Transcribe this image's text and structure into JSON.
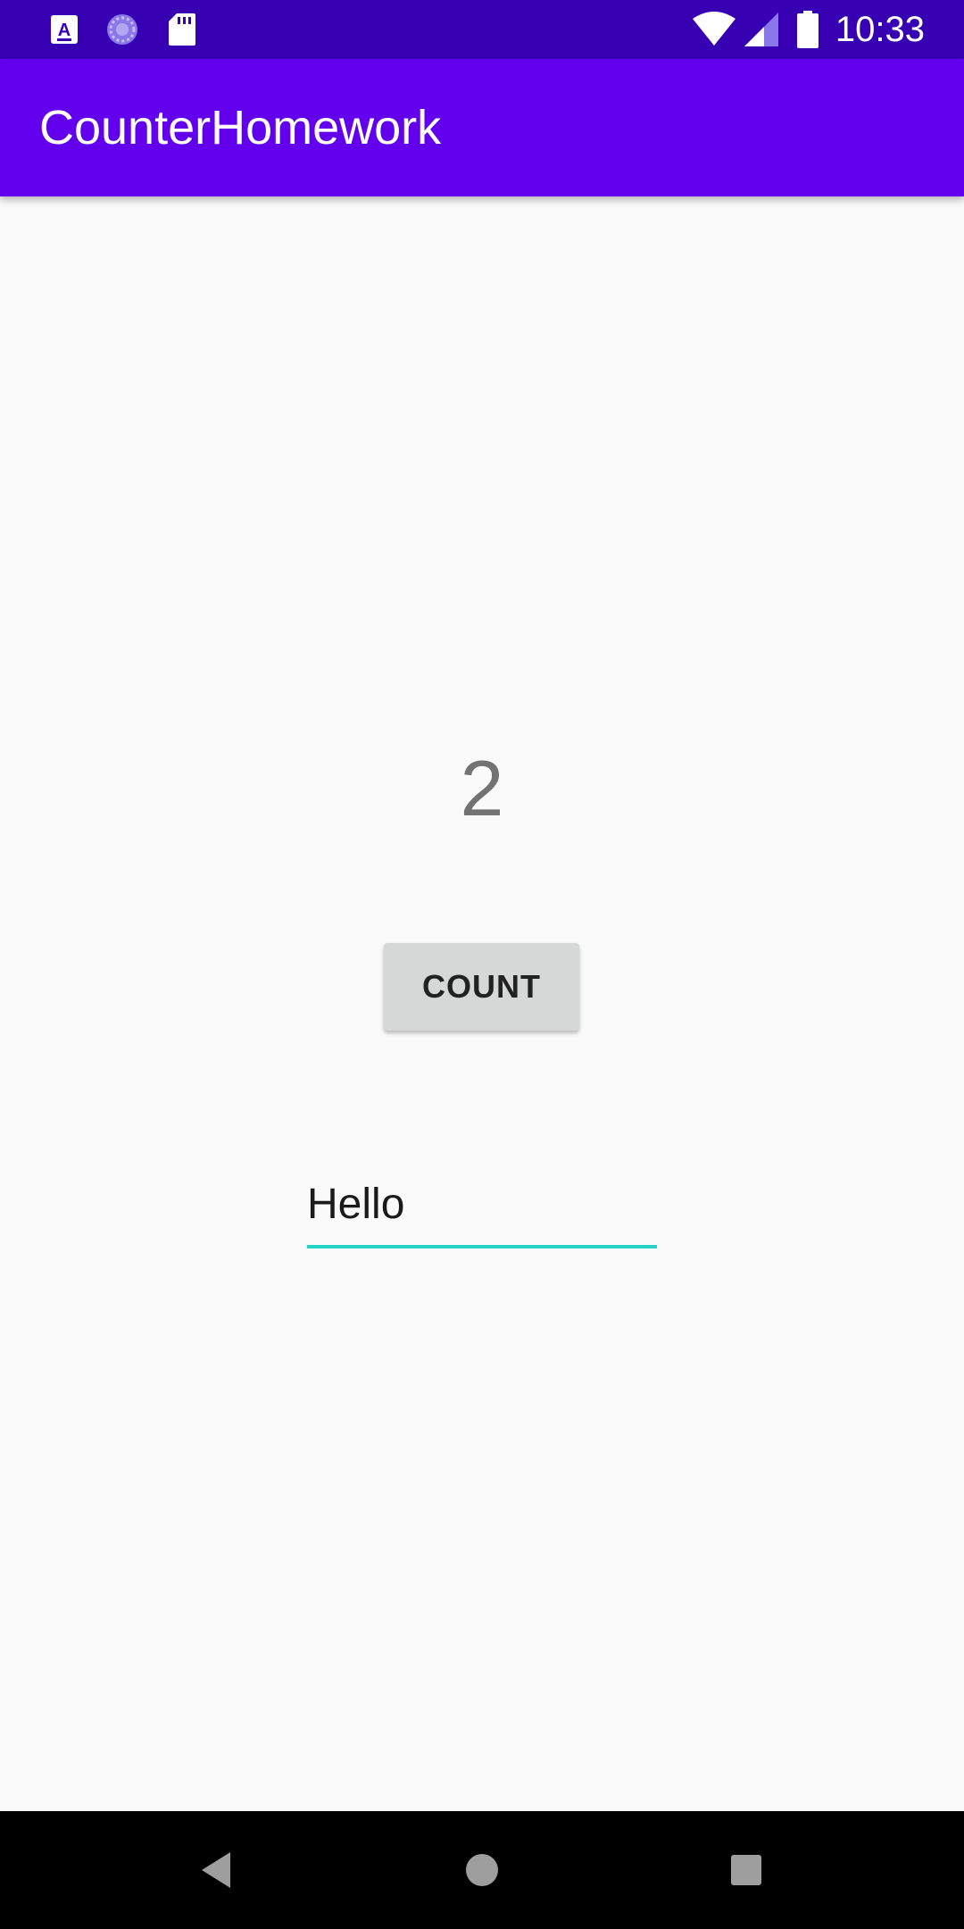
{
  "status_bar": {
    "time": "10:33",
    "left_icons": [
      "keyboard-a-icon",
      "sync-circle-icon",
      "sd-card-icon"
    ],
    "right_icons": [
      "wifi-icon",
      "cell-signal-icon",
      "battery-icon"
    ],
    "background": "#3700b3"
  },
  "app_bar": {
    "title": "CounterHomework",
    "background": "#6200ee"
  },
  "main": {
    "count_value": "2",
    "count_button_label": "COUNT",
    "text_field_value": "Hello",
    "text_field_underline_color": "#26d1c6"
  },
  "nav_bar": {
    "buttons": [
      "back-icon",
      "home-icon",
      "recents-icon"
    ]
  }
}
